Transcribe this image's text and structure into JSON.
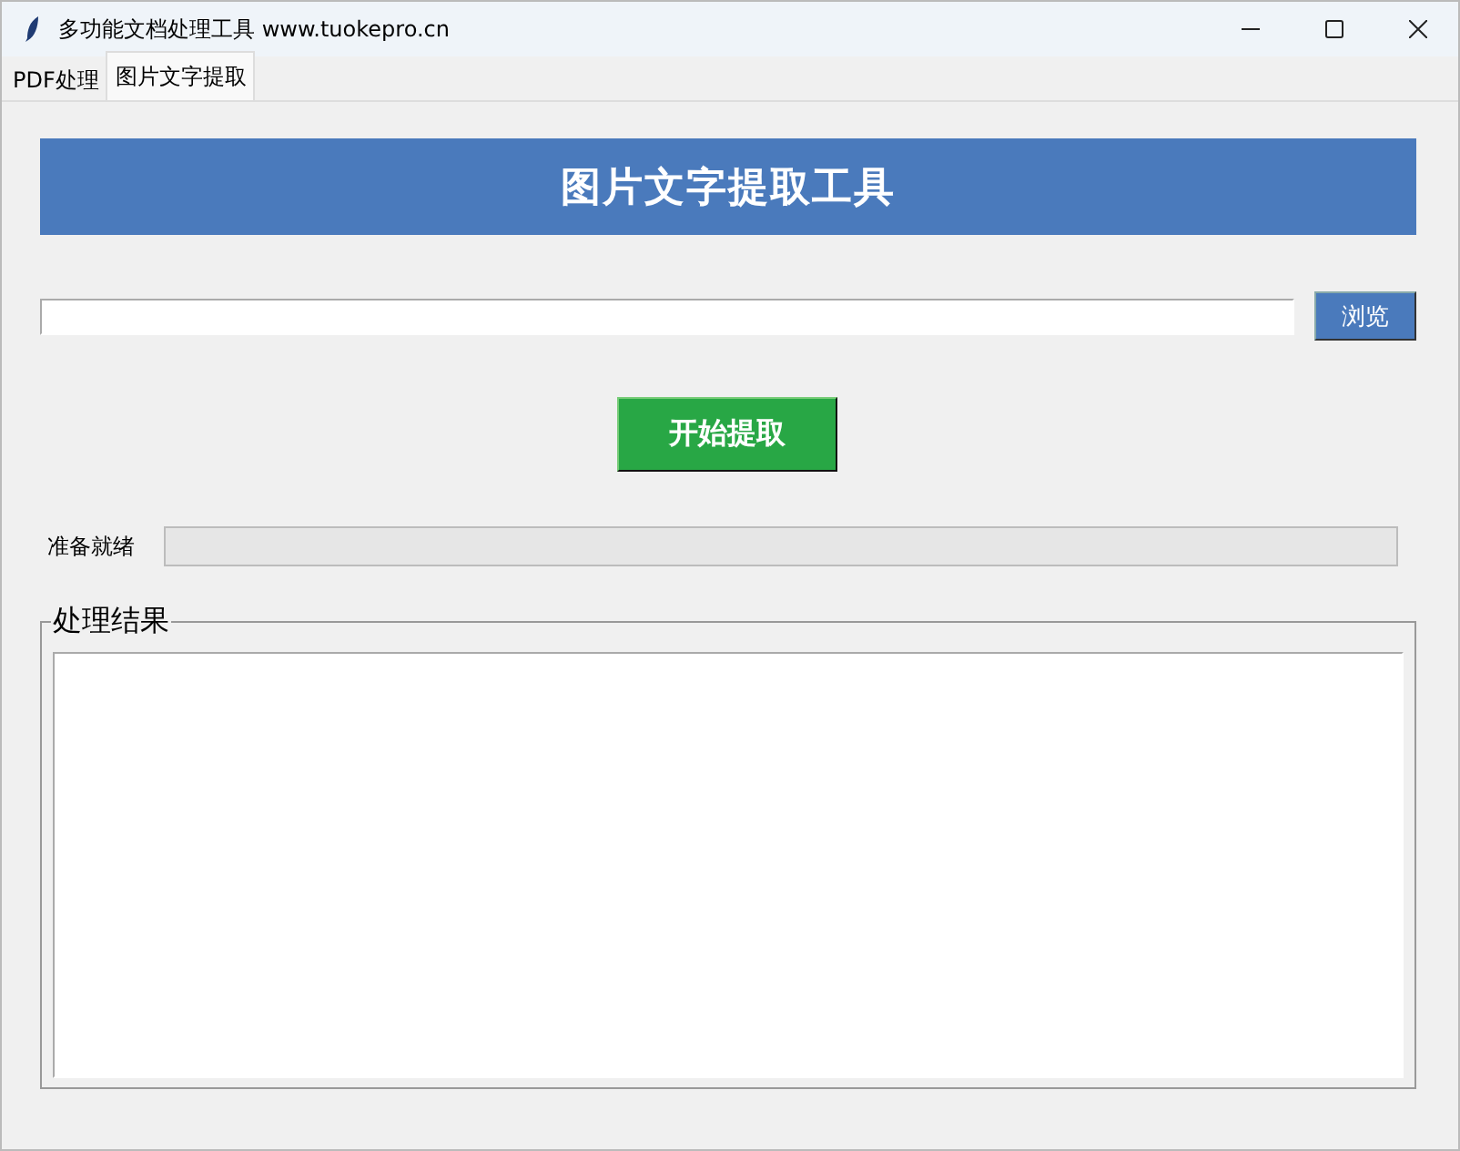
{
  "window": {
    "title": "多功能文档处理工具 www.tuokepro.cn"
  },
  "tabs": [
    {
      "label": "PDF处理",
      "selected": false
    },
    {
      "label": "图片文字提取",
      "selected": true
    }
  ],
  "banner": {
    "title": "图片文字提取工具"
  },
  "browse_button": "浏览",
  "start_button": "开始提取",
  "status": {
    "text": "准备就绪",
    "level": 0
  },
  "result": {
    "title": "处理结果"
  }
}
